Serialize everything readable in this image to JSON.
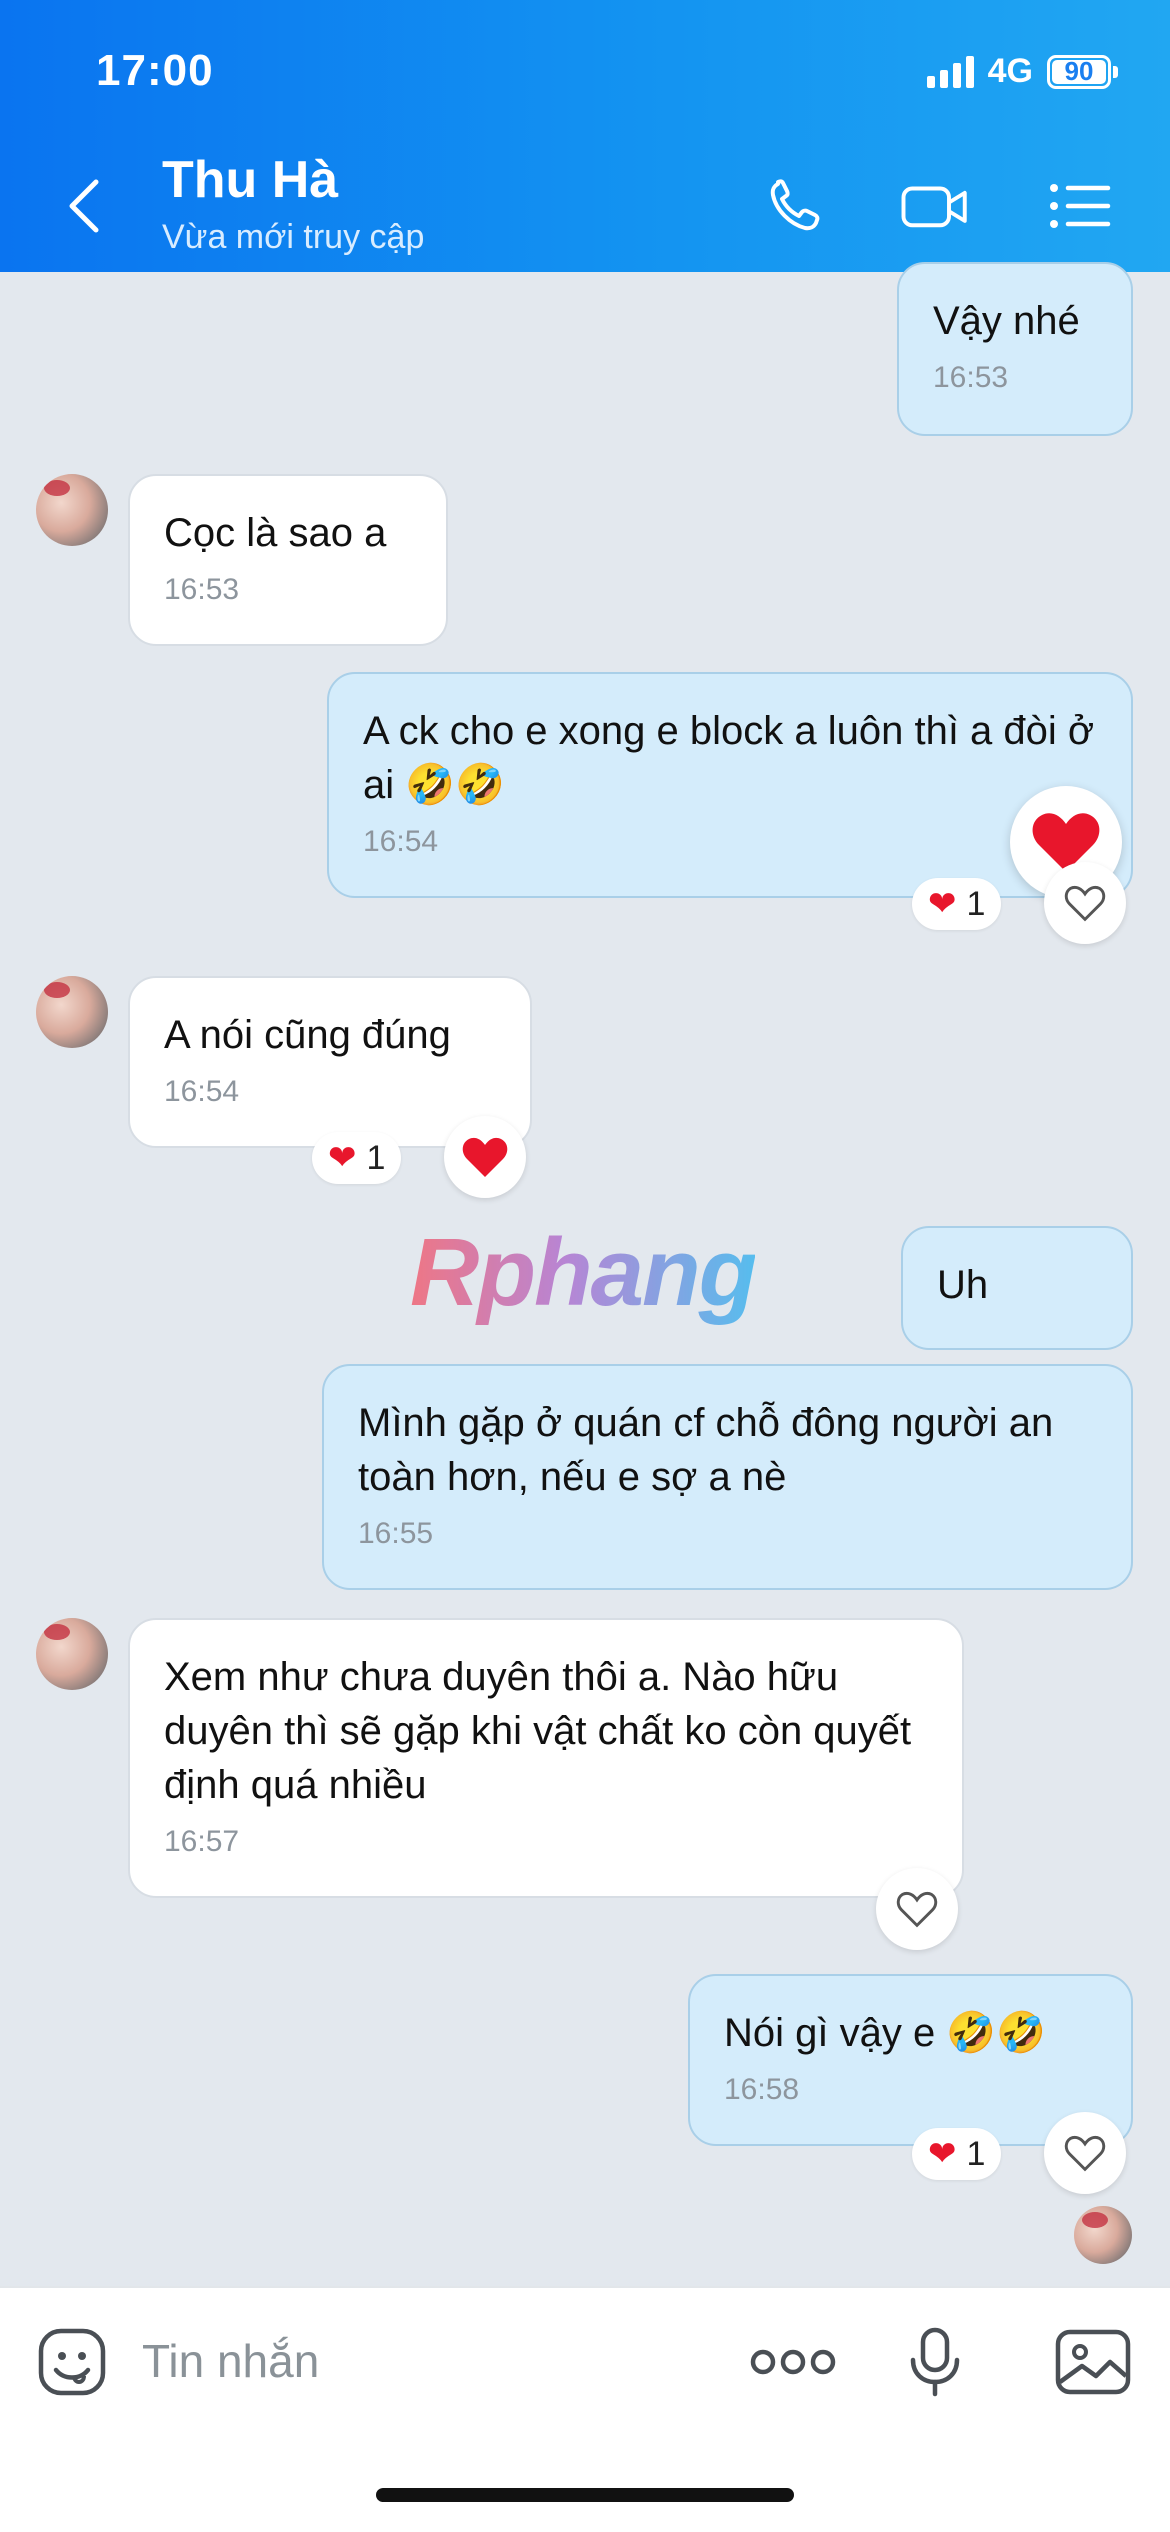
{
  "status_bar": {
    "time": "17:00",
    "network": "4G",
    "battery": "90"
  },
  "header": {
    "contact_name": "Thu Hà",
    "contact_status": "Vừa mới truy cập"
  },
  "messages": [
    {
      "direction": "out",
      "text": "Vậy nhé",
      "time": "16:53"
    },
    {
      "direction": "in",
      "text": "Cọc là sao a",
      "time": "16:53"
    },
    {
      "direction": "out",
      "text": "A ck cho e xong e block a luôn thì a đòi ở ai 🤣🤣",
      "time": "16:54",
      "reaction_count": "1"
    },
    {
      "direction": "in",
      "text": "A nói cũng đúng",
      "time": "16:54",
      "reaction_count": "1"
    },
    {
      "direction": "out",
      "text": "Uh"
    },
    {
      "direction": "out",
      "text": "Mình gặp ở quán cf chỗ đông người an toàn hơn, nếu e sợ a nè",
      "time": "16:55"
    },
    {
      "direction": "in",
      "text": "Xem như chưa duyên thôi a. Nào hữu duyên thì sẽ gặp khi vật chất ko còn quyết định quá nhiều",
      "time": "16:57"
    },
    {
      "direction": "out",
      "text": "Nói gì vậy e 🤣🤣",
      "time": "16:58",
      "reaction_count": "1"
    }
  ],
  "watermark": "Rphang",
  "input": {
    "placeholder": "Tin nhắn"
  },
  "colors": {
    "header_start": "#0a74f0",
    "header_end": "#21a7f2",
    "outgoing_bubble": "#d4ecfb",
    "incoming_bubble": "#ffffff",
    "chat_bg": "#e3e8ee",
    "heart": "#e8162c"
  },
  "icons": [
    "back-icon",
    "phone-icon",
    "video-call-icon",
    "menu-list-icon",
    "heart-icon",
    "sticker-icon",
    "more-icon",
    "microphone-icon",
    "image-icon"
  ]
}
